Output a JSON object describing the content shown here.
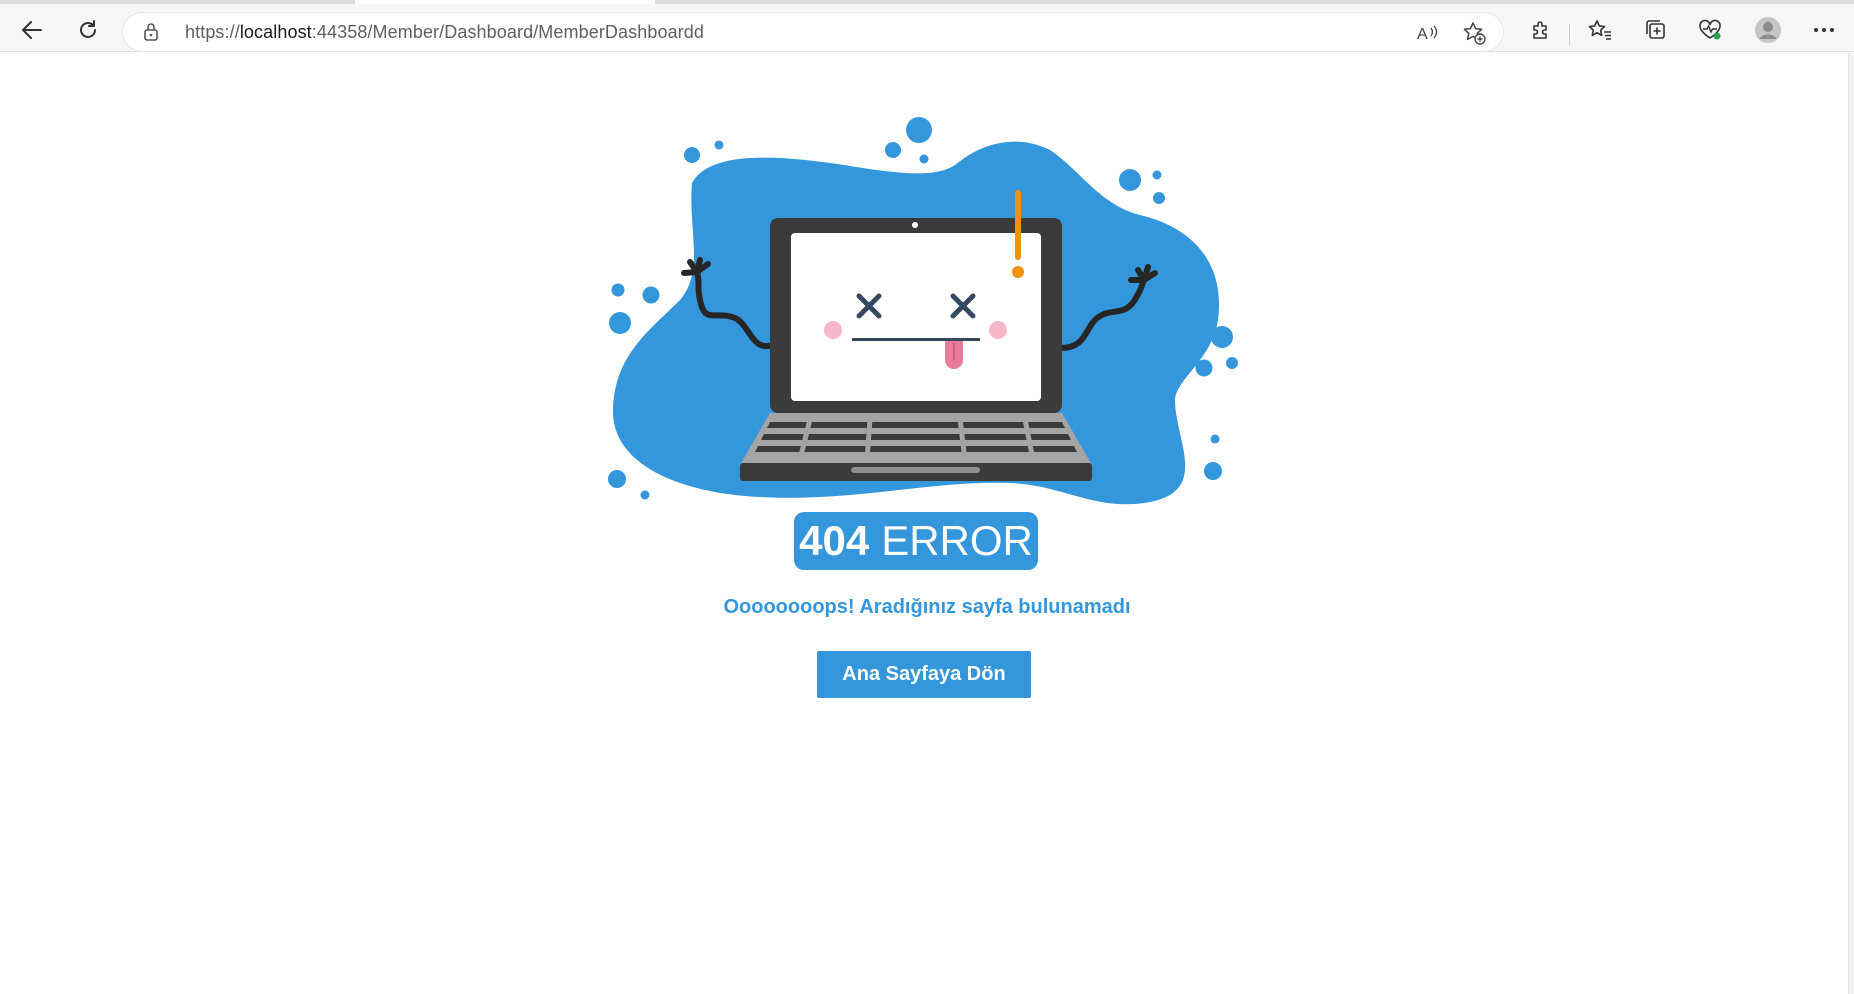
{
  "browser": {
    "url_prefix": "https://",
    "url_host": "localhost",
    "url_rest": ":44358/Member/Dashboard/MemberDashboardd",
    "icons": [
      "back-arrow-icon",
      "refresh-icon",
      "lock-icon",
      "read-aloud-icon",
      "add-favorite-icon",
      "extensions-icon",
      "favorites-icon",
      "collections-icon",
      "browser-essentials-icon",
      "profile-icon",
      "more-options-icon"
    ]
  },
  "error": {
    "code": "404",
    "label": "ERROR",
    "message": "Oooooooops! Aradığınız sayfa bulunamadı",
    "home_button": "Ana Sayfaya Dön"
  },
  "colors": {
    "accent": "#3496db",
    "laptop_dark": "#3b3b3b",
    "exclamation": "#f29111",
    "cheek": "#f6b8c6"
  }
}
